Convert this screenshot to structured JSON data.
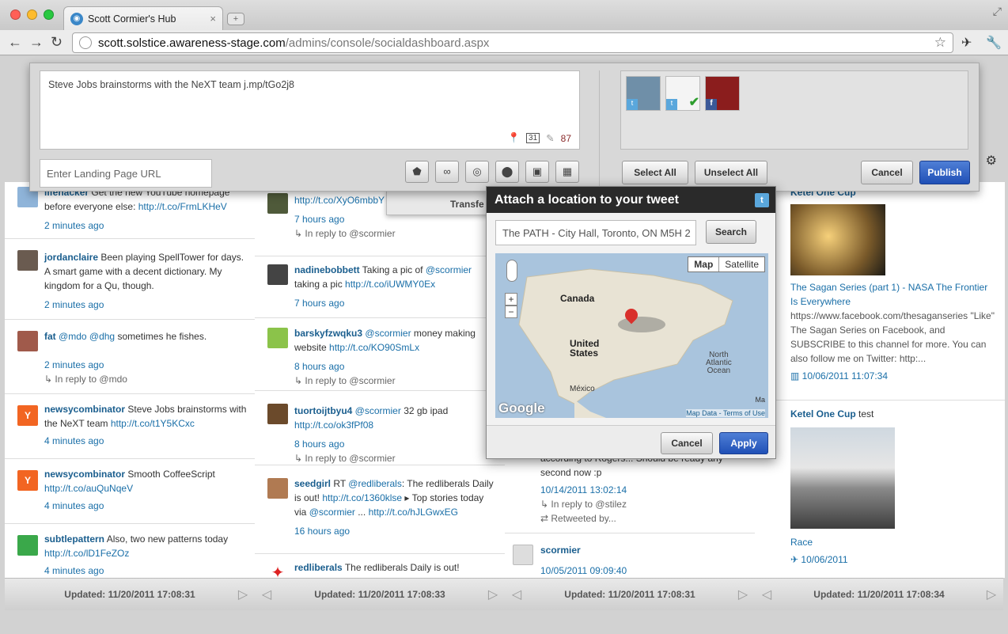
{
  "browser": {
    "tab_title": "Scott Cormier's Hub",
    "tab_close": "×",
    "url_host": "scott.solstice.awareness-stage.com",
    "url_path": "/admins/console/socialdashboard.aspx"
  },
  "compose": {
    "message": "Steve Jobs brainstorms with the NeXT team j.mp/tGo2j8",
    "char_count": "87",
    "landing_url_placeholder": "Enter Landing Page URL",
    "select_all": "Select All",
    "unselect_all": "Unselect All",
    "cancel": "Cancel",
    "publish": "Publish",
    "transfer_fragment": "Transfe"
  },
  "location_popup": {
    "title": "Attach a location to your tweet",
    "location_value": "The PATH - City Hall, Toronto, ON M5H 2",
    "search": "Search",
    "map_tab": "Map",
    "satellite_tab": "Satellite",
    "labels": {
      "canada": "Canada",
      "us1": "United",
      "us2": "States",
      "mexico": "México",
      "atl1": "North",
      "atl2": "Atlantic",
      "atl3": "Ocean",
      "google": "Google",
      "mapdata": "Map Data",
      "terms": "Terms of Use",
      "ma": "Ma"
    },
    "cancel": "Cancel",
    "apply": "Apply"
  },
  "columns": [
    {
      "items": [
        {
          "name": "lifehacker",
          "text": "Get the new YouTube homepage before everyone else:",
          "link": "http://t.co/FrmLKHeV",
          "time": "2 minutes ago"
        },
        {
          "name": "jordanclaire",
          "text": "Been playing SpellTower for days. A smart game with a decent dictionary. My kingdom for a Qu, though.",
          "time": "2 minutes ago"
        },
        {
          "name": "fat",
          "mention1": "@mdo",
          "mention2": "@dhg",
          "text": "sometimes he fishes.",
          "time": "2 minutes ago",
          "reply": "In reply to @mdo"
        },
        {
          "name": "newsycombinator",
          "text": "Steve Jobs brainstorms with the NeXT team",
          "link": "http://t.co/t1Y5KCxc",
          "time": "4 minutes ago"
        },
        {
          "name": "newsycombinator",
          "text": "Smooth CoffeeScript",
          "link": "http://t.co/auQuNqeV",
          "time": "4 minutes ago"
        },
        {
          "name": "subtlepattern",
          "text": "Also, two new patterns today",
          "link": "http://t.co/lD1FeZOz",
          "time": "4 minutes ago"
        }
      ],
      "updated": "Updated: 11/20/2011 17:08:31"
    },
    {
      "items": [
        {
          "link": "http://t.co/XyO6mbbY",
          "time": "7 hours ago",
          "reply": "In reply to @scormier"
        },
        {
          "name": "nadinebobbett",
          "text": "Taking a pic of",
          "mention1": "@scormier",
          "text2": "taking a pic",
          "link": "http://t.co/iUWMY0Ex",
          "time": "7 hours ago"
        },
        {
          "name": "barskyfzwqku3",
          "mention1": "@scormier",
          "text": "money making website",
          "link": "http://t.co/KO90SmLx",
          "time": "8 hours ago",
          "reply": "In reply to @scormier"
        },
        {
          "name": "tuortoijtbyu4",
          "mention1": "@scormier",
          "text": "32 gb ipad",
          "link": "http://t.co/ok3fPf08",
          "time": "8 hours ago",
          "reply": "In reply to @scormier"
        },
        {
          "name": "seedgirl",
          "text": "RT",
          "mention1": "@redliberals",
          "text2": ": The redliberals Daily is out!",
          "link": "http://t.co/1360klse",
          "text3": "Top stories today via",
          "mention2": "@scormier",
          "text4": "...",
          "link2": "http://t.co/hJLGwxEG",
          "time": "16 hours ago"
        },
        {
          "name": "redliberals",
          "text": "The redliberals Daily is out!"
        }
      ],
      "updated": "Updated: 11/20/2011 17:08:33"
    },
    {
      "items": [
        {
          "text": "according to Rogers... Should be ready any second now :p",
          "time": "10/14/2011 13:02:14",
          "reply": "In reply to @stilez",
          "retweet": "Retweeted by..."
        },
        {
          "name": "scormier",
          "time": "10/05/2011 09:09:40"
        }
      ],
      "updated": "Updated: 11/20/2011 17:08:31"
    },
    {
      "items": [
        {
          "name": "Ketel One Cup",
          "title": "The Sagan Series (part 1) - NASA The Frontier Is Everywhere",
          "desc": "https://www.facebook.com/thesaganseries \"Like\" The Sagan Series on Facebook, and SUBSCRIBE to this channel for more. You can also follow me on Twitter: http:...",
          "time": "10/06/2011 11:07:34"
        },
        {
          "name": "Ketel One Cup",
          "text": "test",
          "title": "Race",
          "time": "10/06/2011"
        }
      ],
      "updated": "Updated: 11/20/2011 17:08:34"
    }
  ]
}
